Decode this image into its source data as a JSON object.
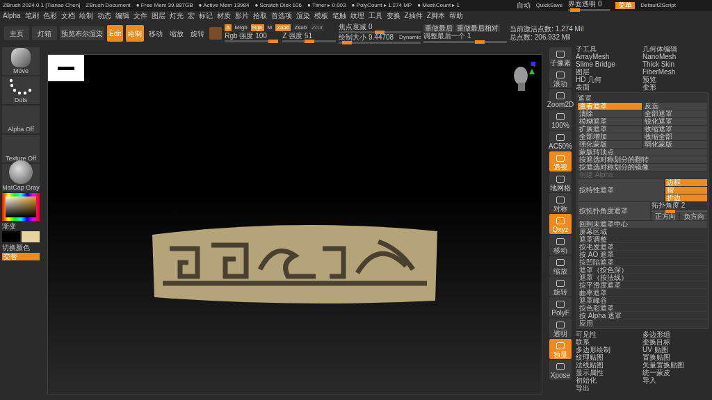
{
  "title_bar": {
    "app": "ZBrush 2024.0.1 [Tianao Chen]",
    "document": "ZBrush Document",
    "stats": [
      "● Free Mem 39.887GB",
      "● Active Mem 13984",
      "● Scratch Disk 106",
      "● Timer ▸ 0.003",
      "● PolyCount ▸ 1.274 MP",
      "● MeshCount ▸ 1"
    ],
    "right": {
      "auto": "自动",
      "quicksave": "QuickSave",
      "opacity": {
        "label": "界面透明 0",
        "level": 0.05
      },
      "menu_button": {
        "label": "菜单",
        "selected": true
      },
      "script": "DefaultZScript"
    }
  },
  "menu_bar": [
    "Alpha",
    "笔刷",
    "色彩",
    "文档",
    "绘制",
    "动态",
    "编辑",
    "文件",
    "图层",
    "灯光",
    "宏",
    "标记",
    "材质",
    "影片",
    "拾取",
    "首选项",
    "渲染",
    "模板",
    "笔触",
    "纹理",
    "工具",
    "变换",
    "Z插件",
    "Z脚本",
    "帮助"
  ],
  "shelf": {
    "nav": [
      {
        "label": "主页"
      },
      {
        "label": "灯箱"
      },
      {
        "label": "预览布尔渲染"
      }
    ],
    "tools": [
      {
        "label": "Edit",
        "selected": true
      },
      {
        "label": "绘制",
        "selected": true
      },
      {
        "label": "移动",
        "selected": false
      },
      {
        "label": "缩放",
        "selected": false
      },
      {
        "label": "旋转",
        "selected": false
      }
    ],
    "modes_top": [
      {
        "label": "A",
        "selected": true,
        "disabled": false
      },
      {
        "label": "Mrgb",
        "selected": false,
        "disabled": false
      },
      {
        "label": "Rgb",
        "selected": true,
        "disabled": false
      },
      {
        "label": "M",
        "selected": false,
        "disabled": false
      },
      {
        "label": "Zadd",
        "selected": true,
        "disabled": false
      },
      {
        "label": "Zsub",
        "selected": false,
        "disabled": false
      },
      {
        "label": "Zcut",
        "selected": false,
        "disabled": true
      }
    ],
    "intensity": [
      {
        "label": "Rgb 强度 100",
        "level": 1.0
      },
      {
        "label": "Z 强度 51",
        "level": 0.51
      }
    ],
    "focal": {
      "label": "焦点衰减 0",
      "level": 0.5
    },
    "draw_size": {
      "label": "绘制大小 9.44708",
      "level": 0.05,
      "badge": "Dynamic"
    },
    "redo": [
      {
        "label": "重做最后"
      },
      {
        "label": "重做最后相对"
      }
    ],
    "adjust": {
      "label": "调整最后一个 1",
      "level": 0.7
    },
    "points": [
      "当前激活点数: 1.274 Mil",
      "总点数: 206.932 Mil"
    ]
  },
  "left_panel": {
    "thumbs": [
      {
        "kind": "brush",
        "label": "Move"
      },
      {
        "kind": "stroke",
        "label": "Dots"
      },
      {
        "kind": "empty",
        "label": "Alpha Off"
      },
      {
        "kind": "empty",
        "label": "Texture Off"
      },
      {
        "kind": "material",
        "label": "MatCap Gray"
      }
    ],
    "gradient": "渐变",
    "swatches": [
      {
        "color": "#000000"
      },
      {
        "color": "#e6d3a0"
      }
    ],
    "switch": "切换颜色",
    "alternate": {
      "label": "交替",
      "selected": true
    }
  },
  "right_toolbar": [
    {
      "label": "子像素",
      "selected": false
    },
    {
      "label": "滚动",
      "selected": false
    },
    {
      "label": "Zoom2D",
      "selected": false
    },
    {
      "label": "100%",
      "selected": false
    },
    {
      "label": "AC50%",
      "selected": false
    },
    {
      "label": "透视",
      "selected": true
    },
    {
      "label": "地网格",
      "selected": false
    },
    {
      "label": "对称",
      "selected": false
    },
    {
      "label": "Qxyz",
      "selected": true
    },
    {
      "label": "移动",
      "selected": false
    },
    {
      "label": "缩放",
      "selected": false
    },
    {
      "label": "旋转",
      "selected": false
    },
    {
      "label": "PolyF",
      "selected": false
    },
    {
      "label": "透明",
      "selected": false
    },
    {
      "label": "独显",
      "selected": true
    },
    {
      "label": "Xpose",
      "selected": false
    }
  ],
  "tool_menu_top": [
    "子工具",
    "几何体编辑",
    "ArrayMesh",
    "NanoMesh",
    "Slime Bridge",
    "Thick Skin",
    "图层",
    "FiberMesh",
    "HD 几何",
    "预览",
    "表面",
    "变形"
  ],
  "mask_panel": {
    "title": "遮罩",
    "rows": [
      {
        "kind": "pair",
        "buttons": [
          {
            "label": "查看遮罩",
            "selected": true
          },
          {
            "label": "反选",
            "selected": false
          }
        ]
      },
      {
        "kind": "pair",
        "buttons": [
          {
            "label": "清除",
            "selected": false
          },
          {
            "label": "全部遮罩",
            "selected": false
          }
        ]
      },
      {
        "kind": "pair",
        "buttons": [
          {
            "label": "模糊遮罩",
            "selected": false
          },
          {
            "label": "锐化遮罩",
            "selected": false
          }
        ]
      },
      {
        "kind": "pair",
        "buttons": [
          {
            "label": "扩展遮罩",
            "selected": false
          },
          {
            "label": "收缩遮罩",
            "selected": false
          }
        ]
      },
      {
        "kind": "pair",
        "buttons": [
          {
            "label": "全部增加",
            "selected": false
          },
          {
            "label": "收缩全部",
            "selected": false
          }
        ]
      },
      {
        "kind": "pair",
        "buttons": [
          {
            "label": "强化蒙版",
            "selected": false
          },
          {
            "label": "弱化蒙版",
            "selected": false
          }
        ]
      },
      {
        "kind": "button",
        "label": "蒙版转顶点"
      },
      {
        "kind": "button",
        "label": "按遮选对称划分的翻转"
      },
      {
        "kind": "button",
        "label": "按遮选对称划分的镜像"
      },
      {
        "kind": "disabled",
        "label": "创建 Alpha"
      },
      {
        "kind": "feature",
        "label": "按特性遮罩",
        "options": [
          {
            "label": "边框",
            "on": true
          },
          {
            "label": "褶",
            "on": true
          },
          {
            "label": "折边",
            "on": true
          }
        ]
      },
      {
        "kind": "angle",
        "label": "按拓扑角度遮罩",
        "slider": {
          "label": "拓扑角度 2",
          "level": 0.3
        },
        "buttons": [
          {
            "label": "正方向"
          },
          {
            "label": "负方向"
          }
        ]
      },
      {
        "kind": "button",
        "label": "回到未遮罩中心"
      },
      {
        "kind": "row",
        "label": "屏幕区域"
      },
      {
        "kind": "row",
        "label": "遮罩调整"
      },
      {
        "kind": "row",
        "label": "按毛发遮罩"
      },
      {
        "kind": "row",
        "label": "按 AO 遮罩"
      },
      {
        "kind": "row",
        "label": "按凹陷遮罩"
      },
      {
        "kind": "row",
        "label": "遮罩（按色深）"
      },
      {
        "kind": "row",
        "label": "遮罩（按法线）"
      },
      {
        "kind": "row",
        "label": "按平滑度遮罩"
      },
      {
        "kind": "row",
        "label": "曲率遮罩"
      },
      {
        "kind": "row",
        "label": "遮罩峰谷"
      },
      {
        "kind": "row",
        "label": "按色彩遮罩"
      },
      {
        "kind": "row",
        "label": "按 Alpha 遮罩"
      },
      {
        "kind": "row",
        "label": "应用"
      }
    ]
  },
  "tool_menu_bottom": [
    "可见性",
    "多边形组",
    "联系",
    "变换目标",
    "多边形绘制",
    "UV 贴图",
    "纹理贴图",
    "置换贴图",
    "法线贴图",
    "矢量置换贴图",
    "显示属性",
    "统一蒙皮",
    "初始化",
    "导入",
    "导出"
  ]
}
